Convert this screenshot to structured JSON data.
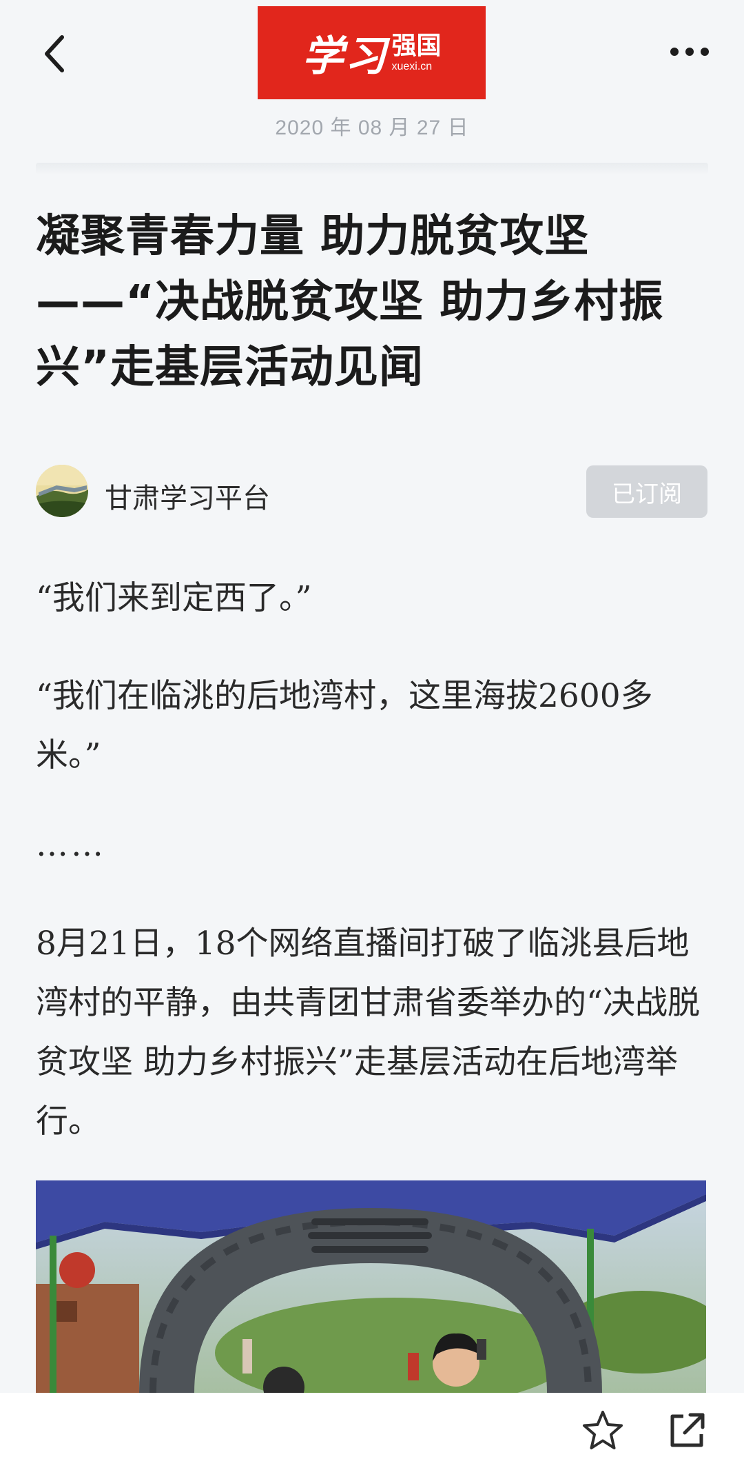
{
  "header": {
    "logo": {
      "main": "学习",
      "sub": "强国",
      "url": "xuexi.cn",
      "color": "#e1261c"
    },
    "date": "2020 年 08 月 27 日",
    "icons": [
      "back-icon",
      "more-icon"
    ]
  },
  "article": {
    "title_lines": [
      "凝聚青春力量 助力脱贫攻坚",
      "——“决战脱贫攻坚 助力乡村振",
      "兴”走基层活动见闻"
    ],
    "author": {
      "name": "甘肃学习平台",
      "subscribe_label": "已订阅"
    },
    "paragraphs": [
      "“我们来到定西了。”",
      "“我们在临洮的后地湾村，这里海拔2600多米。”",
      "……",
      "8月21日，18个网络直播间打破了临洮县后地湾村的平静，由共青团甘肃省委举办的“决战脱贫攻坚 助力乡村振兴”走基层活动在后地湾举行。"
    ]
  },
  "footer": {
    "icons": [
      "star-icon",
      "share-icon"
    ]
  },
  "colors": {
    "background": "#f4f6f8",
    "brand_red": "#e1261c",
    "subscribed_button": "#d3d6da",
    "date_text": "#a2a7ae"
  }
}
